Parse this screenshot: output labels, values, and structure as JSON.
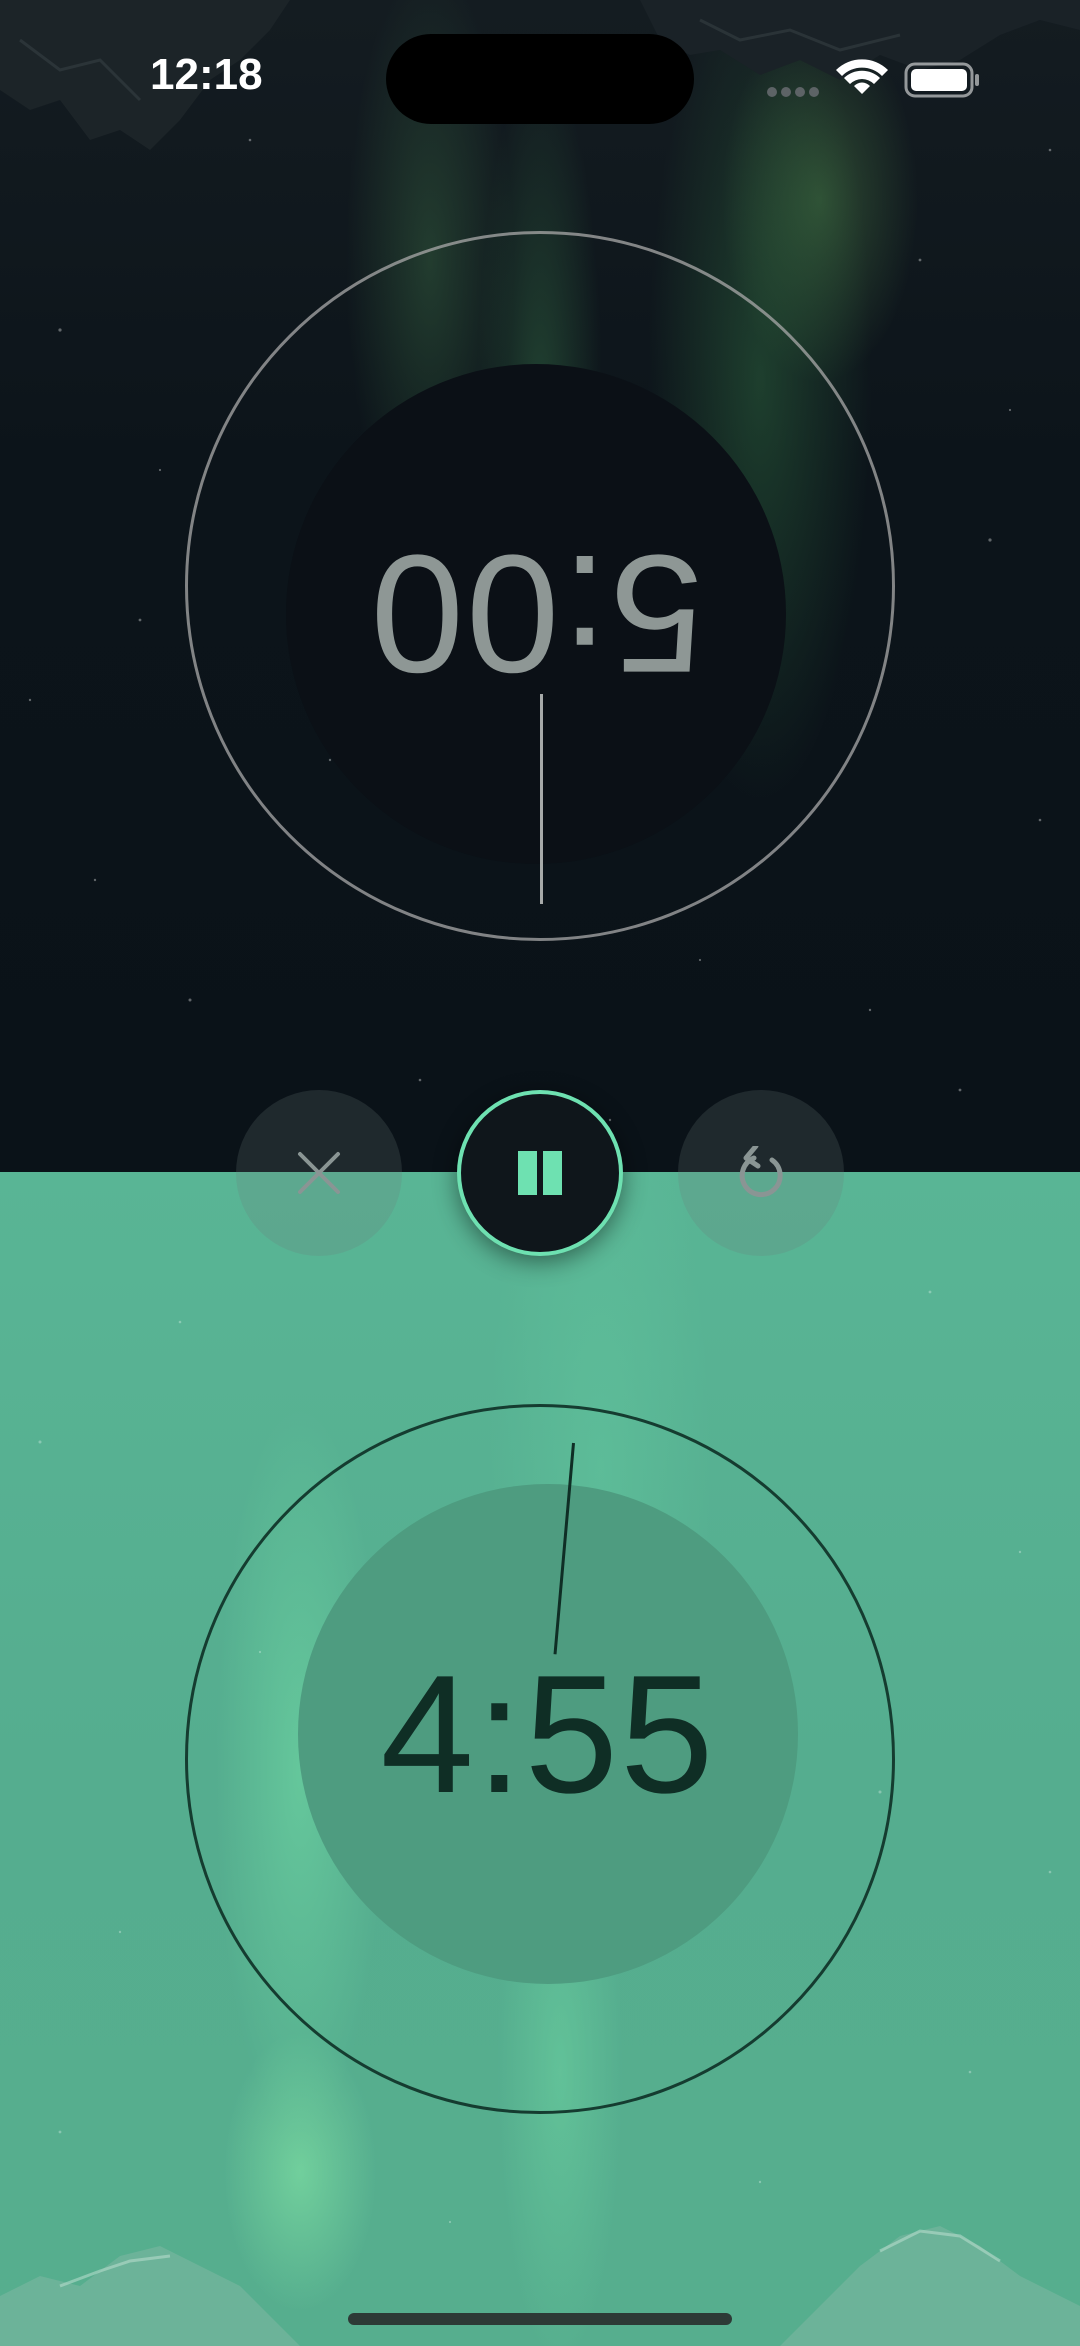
{
  "status_bar": {
    "time": "12:18",
    "signal_icon": "cellular-signal-dots-icon",
    "wifi_icon": "wifi-icon",
    "battery_icon": "battery-full-icon"
  },
  "opponent_timer": {
    "time": "5:00",
    "orientation": "upside-down",
    "color": "#8e9795"
  },
  "player_timer": {
    "time": "4:55",
    "color": "#0f2e25",
    "background": "#56ae8e"
  },
  "controls": {
    "cancel_icon": "close-icon",
    "pause_icon": "pause-icon",
    "reset_icon": "reset-icon",
    "accent_color": "#6ee1b1"
  }
}
